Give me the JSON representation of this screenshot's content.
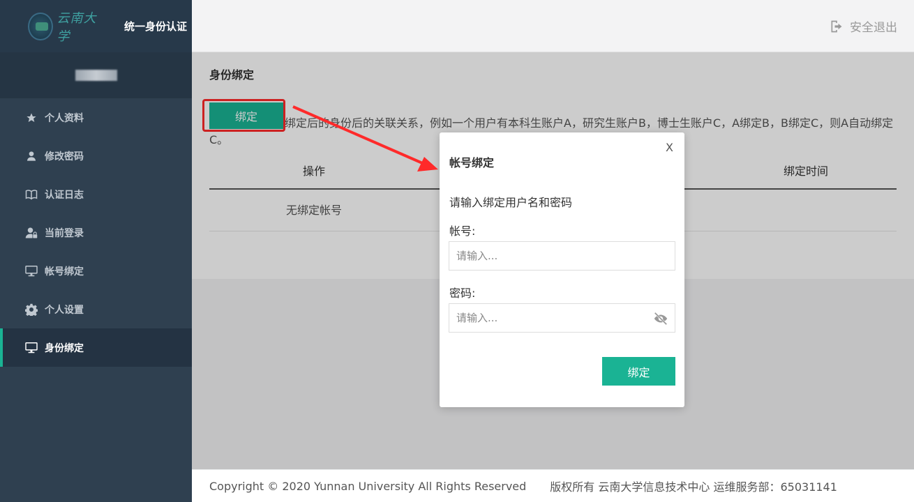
{
  "sidebar": {
    "logo_text": "云南大学",
    "brand_title": "统一身份认证",
    "items": [
      {
        "label": "个人资料",
        "icon": "star-icon"
      },
      {
        "label": "修改密码",
        "icon": "user-icon"
      },
      {
        "label": "认证日志",
        "icon": "book-icon"
      },
      {
        "label": "当前登录",
        "icon": "user-lock-icon"
      },
      {
        "label": "帐号绑定",
        "icon": "monitor-icon"
      },
      {
        "label": "个人设置",
        "icon": "gear-icon"
      },
      {
        "label": "身份绑定",
        "icon": "monitor-icon",
        "active": true
      }
    ]
  },
  "header": {
    "logout_label": "安全退出"
  },
  "main": {
    "title": "身份绑定",
    "bind_button": "绑定",
    "description": "绑定后的身份后的关联关系，例如一个用户有本科生账户A，研究生账户B，博士生账户C，A绑定B，B绑定C，则A自动绑定C。",
    "table": {
      "headers": [
        "操作",
        "绑定时间"
      ],
      "empty_text": "无绑定帐号"
    }
  },
  "footer": {
    "copyright": "Copyright © 2020 Yunnan University All Rights Reserved",
    "rights": "版权所有 云南大学信息技术中心 运维服务部：65031141"
  },
  "modal": {
    "close_label": "X",
    "title": "帐号绑定",
    "prompt": "请输入绑定用户名和密码",
    "account_label": "帐号:",
    "account_placeholder": "请输入...",
    "password_label": "密码:",
    "password_placeholder": "请输入...",
    "submit_label": "绑定"
  },
  "colors": {
    "accent": "#1ab394",
    "sidebar_bg": "#2f4050",
    "annotation": "#ff2a2a"
  }
}
